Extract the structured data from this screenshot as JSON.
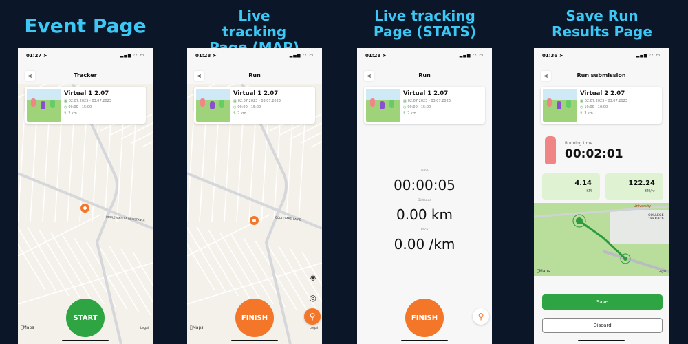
{
  "colors": {
    "background": "#0b1628",
    "title": "#3cc8f5",
    "start": "#2ea443",
    "finish": "#f47629",
    "save": "#2ea443"
  },
  "screens": [
    {
      "heading": "Event Page",
      "time": "01:27",
      "nav_title": "Tracker",
      "event": {
        "name": "Virtual 1 2.07",
        "dates": "02.07.2023 - 03.07.2023",
        "hours": "09:00 - 15:00",
        "distance": "2 km"
      },
      "button": "START",
      "maps_label": "Maps",
      "legal": "Legal",
      "street": "BOULEVARD LA RESISTANCE"
    },
    {
      "heading": "Live tracking Page (MAP)",
      "time": "01:28",
      "nav_title": "Run",
      "event": {
        "name": "Virtual 1 2.07",
        "dates": "02.07.2023 - 03.07.2023",
        "hours": "09:00 - 15:00",
        "distance": "2 km"
      },
      "button": "FINISH",
      "maps_label": "Maps",
      "legal": "Legal",
      "street": "BOULEVARD LA RE"
    },
    {
      "heading": "Live tracking Page (STATS)",
      "time": "01:28",
      "nav_title": "Run",
      "event": {
        "name": "Virtual 1 2.07",
        "dates": "02.07.2023 - 03.07.2023",
        "hours": "09:00 - 15:00",
        "distance": "2 km"
      },
      "button": "FINISH",
      "stats": [
        {
          "label": "Time",
          "value": "00:00:05"
        },
        {
          "label": "Distance",
          "value": "0.00 km"
        },
        {
          "label": "Pace",
          "value": "0.00 /km"
        }
      ]
    },
    {
      "heading": "Save Run Results Page",
      "time": "01:36",
      "nav_title": "Run submission",
      "event": {
        "name": "Virtual 2 2.07",
        "dates": "02.07.2023 - 03.07.2023",
        "hours": "10:00 - 10:00",
        "distance": "3 km"
      },
      "running_time_label": "Running time",
      "running_time": "00:02:01",
      "distance_value": "4.14",
      "distance_unit": "KM",
      "speed_value": "122.24",
      "speed_unit": "KM/hr",
      "map_labels": {
        "university": "University",
        "college": "COLLEGE TERRACE",
        "maps": "Maps",
        "legal": "Legal"
      },
      "save": "Save",
      "discard": "Discard"
    }
  ]
}
